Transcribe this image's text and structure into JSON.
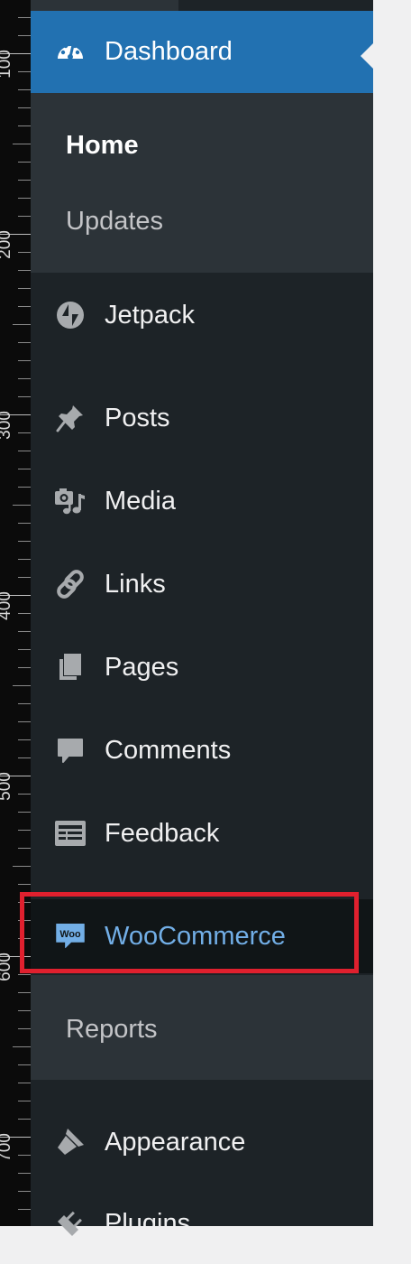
{
  "ruler": {
    "labels": [
      "100",
      "200",
      "300",
      "400",
      "500",
      "600",
      "700"
    ]
  },
  "menu": {
    "dashboard": {
      "label": "Dashboard",
      "icon": "dashboard-gauge-icon"
    },
    "dashboard_sub": [
      {
        "label": "Home",
        "current": true
      },
      {
        "label": "Updates",
        "current": false
      }
    ],
    "items": [
      {
        "key": "jetpack",
        "label": "Jetpack",
        "icon": "jetpack-icon"
      },
      {
        "key": "posts",
        "label": "Posts",
        "icon": "pushpin-icon"
      },
      {
        "key": "media",
        "label": "Media",
        "icon": "media-camera-music-icon"
      },
      {
        "key": "links",
        "label": "Links",
        "icon": "chain-link-icon"
      },
      {
        "key": "pages",
        "label": "Pages",
        "icon": "pages-icon"
      },
      {
        "key": "comments",
        "label": "Comments",
        "icon": "speech-bubble-icon"
      },
      {
        "key": "feedback",
        "label": "Feedback",
        "icon": "feedback-form-icon"
      }
    ],
    "woocommerce": {
      "label": "WooCommerce",
      "icon": "woo-logo-icon",
      "logo_text": "Woo"
    },
    "woocommerce_sub": [
      {
        "label": "Reports"
      }
    ],
    "after": [
      {
        "key": "appearance",
        "label": "Appearance",
        "icon": "paintbrush-icon"
      },
      {
        "key": "plugins",
        "label": "Plugins",
        "icon": "plugin-icon"
      }
    ]
  },
  "colors": {
    "sidebar_bg": "#1d2327",
    "submenu_bg": "#2c3338",
    "active_bg": "#2271b1",
    "woo_text": "#72aee6",
    "highlight_border": "#e0202e",
    "icon_gray": "#a7aaad"
  }
}
